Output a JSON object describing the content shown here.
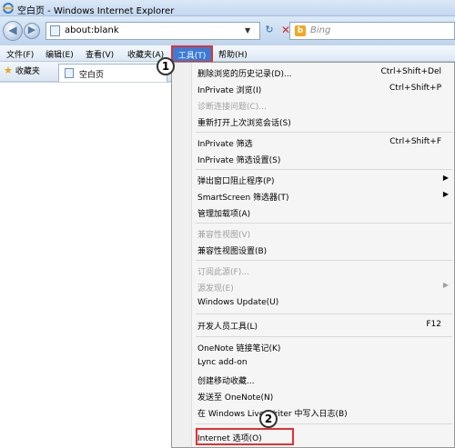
{
  "window": {
    "title": "空白页 - Windows Internet Explorer"
  },
  "navigation": {
    "address": "about:blank",
    "search_placeholder": "Bing"
  },
  "menubar": {
    "items": [
      "文件(F)",
      "编辑(E)",
      "查看(V)",
      "收藏夹(A)",
      "工具(T)",
      "帮助(H)"
    ]
  },
  "favorites_bar": {
    "favorites_label": "收藏夹",
    "tab_label": "空白页"
  },
  "tools_menu": {
    "items": [
      {
        "label": "删除浏览的历史记录(D)...",
        "shortcut": "Ctrl+Shift+Del",
        "disabled": false
      },
      {
        "label": "InPrivate 浏览(I)",
        "shortcut": "Ctrl+Shift+P",
        "disabled": false
      },
      {
        "label": "诊断连接问题(C)...",
        "shortcut": "",
        "disabled": true
      },
      {
        "label": "重新打开上次浏览会话(S)",
        "shortcut": "",
        "disabled": false
      },
      {
        "label": "InPrivate 筛选",
        "shortcut": "Ctrl+Shift+F",
        "disabled": false
      },
      {
        "label": "InPrivate 筛选设置(S)",
        "shortcut": "",
        "disabled": false
      },
      {
        "label": "弹出窗口阻止程序(P)",
        "shortcut": "",
        "submenu": true,
        "disabled": false
      },
      {
        "label": "SmartScreen 筛选器(T)",
        "shortcut": "",
        "submenu": true,
        "disabled": false
      },
      {
        "label": "管理加载项(A)",
        "shortcut": "",
        "disabled": false
      },
      {
        "label": "兼容性视图(V)",
        "shortcut": "",
        "disabled": true
      },
      {
        "label": "兼容性视图设置(B)",
        "shortcut": "",
        "disabled": false
      },
      {
        "label": "订阅此源(F)...",
        "shortcut": "",
        "disabled": true
      },
      {
        "label": "源发现(E)",
        "shortcut": "",
        "submenu": true,
        "disabled": true
      },
      {
        "label": "Windows Update(U)",
        "shortcut": "",
        "disabled": false
      },
      {
        "label": "开发人员工具(L)",
        "shortcut": "F12",
        "disabled": false
      },
      {
        "label": "OneNote 链接笔记(K)",
        "shortcut": "",
        "disabled": false
      },
      {
        "label": "Lync add-on",
        "shortcut": "",
        "disabled": false
      },
      {
        "label": "创建移动收藏...",
        "shortcut": "",
        "disabled": false
      },
      {
        "label": "发送至 OneNote(N)",
        "shortcut": "",
        "disabled": false
      },
      {
        "label": "在 Windows Live Writer 中写入日志(B)",
        "shortcut": "",
        "disabled": false
      },
      {
        "label": "Internet 选项(O)",
        "shortcut": "",
        "disabled": false
      }
    ]
  },
  "callouts": [
    "1",
    "2"
  ],
  "colors": {
    "highlight_border": "#e53030",
    "menu_selected": "#3a7bd5"
  }
}
